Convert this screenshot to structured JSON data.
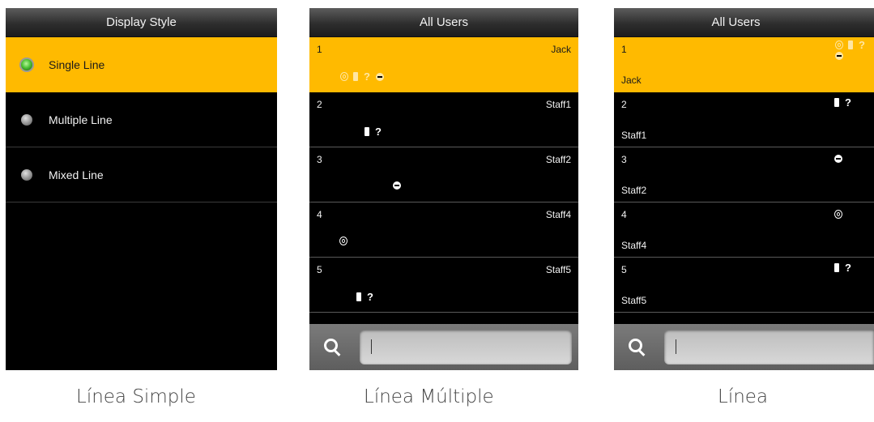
{
  "display_style": {
    "title": "Display Style",
    "options": [
      {
        "label": "Single Line",
        "selected": true
      },
      {
        "label": "Multiple Line",
        "selected": false
      },
      {
        "label": "Mixed Line",
        "selected": false
      }
    ]
  },
  "multiple_line": {
    "title": "All Users",
    "rows": [
      {
        "num": "1",
        "name": "Jack"
      },
      {
        "num": "2",
        "name": "Staff1"
      },
      {
        "num": "3",
        "name": "Staff2"
      },
      {
        "num": "4",
        "name": "Staff4"
      },
      {
        "num": "5",
        "name": "Staff5"
      }
    ],
    "search_value": ""
  },
  "mixed_line": {
    "title": "All Users",
    "rows": [
      {
        "num": "1",
        "name": "Jack"
      },
      {
        "num": "2",
        "name": "Staff1"
      },
      {
        "num": "3",
        "name": "Staff2"
      },
      {
        "num": "4",
        "name": "Staff4"
      },
      {
        "num": "5",
        "name": "Staff5"
      }
    ],
    "search_value": ""
  },
  "captions": [
    "Línea Simple",
    "Línea Múltiple",
    "Línea"
  ],
  "colors": {
    "highlight": "#ffba00",
    "background": "#000000"
  },
  "icons": [
    "fingerprint-icon",
    "card-icon",
    "password-icon",
    "face-icon",
    "search-icon"
  ]
}
